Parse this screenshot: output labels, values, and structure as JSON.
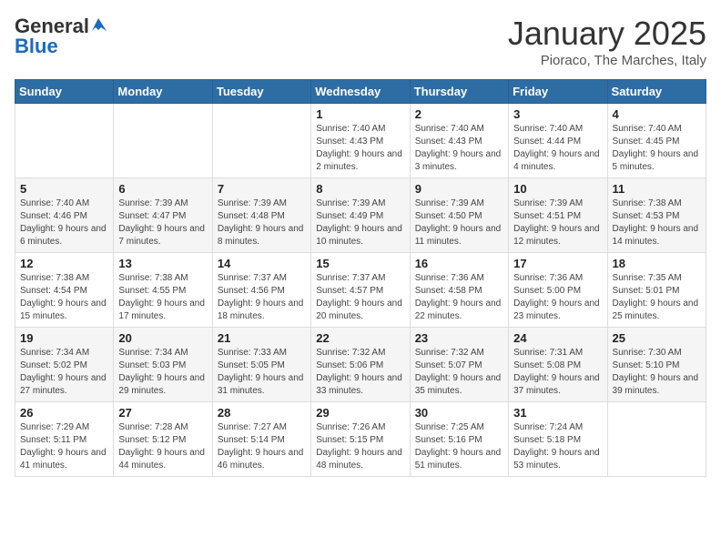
{
  "header": {
    "logo_general": "General",
    "logo_blue": "Blue",
    "month_title": "January 2025",
    "location": "Pioraco, The Marches, Italy"
  },
  "days_of_week": [
    "Sunday",
    "Monday",
    "Tuesday",
    "Wednesday",
    "Thursday",
    "Friday",
    "Saturday"
  ],
  "weeks": [
    [
      {
        "day": "",
        "info": ""
      },
      {
        "day": "",
        "info": ""
      },
      {
        "day": "",
        "info": ""
      },
      {
        "day": "1",
        "info": "Sunrise: 7:40 AM\nSunset: 4:43 PM\nDaylight: 9 hours and 2 minutes."
      },
      {
        "day": "2",
        "info": "Sunrise: 7:40 AM\nSunset: 4:43 PM\nDaylight: 9 hours and 3 minutes."
      },
      {
        "day": "3",
        "info": "Sunrise: 7:40 AM\nSunset: 4:44 PM\nDaylight: 9 hours and 4 minutes."
      },
      {
        "day": "4",
        "info": "Sunrise: 7:40 AM\nSunset: 4:45 PM\nDaylight: 9 hours and 5 minutes."
      }
    ],
    [
      {
        "day": "5",
        "info": "Sunrise: 7:40 AM\nSunset: 4:46 PM\nDaylight: 9 hours and 6 minutes."
      },
      {
        "day": "6",
        "info": "Sunrise: 7:39 AM\nSunset: 4:47 PM\nDaylight: 9 hours and 7 minutes."
      },
      {
        "day": "7",
        "info": "Sunrise: 7:39 AM\nSunset: 4:48 PM\nDaylight: 9 hours and 8 minutes."
      },
      {
        "day": "8",
        "info": "Sunrise: 7:39 AM\nSunset: 4:49 PM\nDaylight: 9 hours and 10 minutes."
      },
      {
        "day": "9",
        "info": "Sunrise: 7:39 AM\nSunset: 4:50 PM\nDaylight: 9 hours and 11 minutes."
      },
      {
        "day": "10",
        "info": "Sunrise: 7:39 AM\nSunset: 4:51 PM\nDaylight: 9 hours and 12 minutes."
      },
      {
        "day": "11",
        "info": "Sunrise: 7:38 AM\nSunset: 4:53 PM\nDaylight: 9 hours and 14 minutes."
      }
    ],
    [
      {
        "day": "12",
        "info": "Sunrise: 7:38 AM\nSunset: 4:54 PM\nDaylight: 9 hours and 15 minutes."
      },
      {
        "day": "13",
        "info": "Sunrise: 7:38 AM\nSunset: 4:55 PM\nDaylight: 9 hours and 17 minutes."
      },
      {
        "day": "14",
        "info": "Sunrise: 7:37 AM\nSunset: 4:56 PM\nDaylight: 9 hours and 18 minutes."
      },
      {
        "day": "15",
        "info": "Sunrise: 7:37 AM\nSunset: 4:57 PM\nDaylight: 9 hours and 20 minutes."
      },
      {
        "day": "16",
        "info": "Sunrise: 7:36 AM\nSunset: 4:58 PM\nDaylight: 9 hours and 22 minutes."
      },
      {
        "day": "17",
        "info": "Sunrise: 7:36 AM\nSunset: 5:00 PM\nDaylight: 9 hours and 23 minutes."
      },
      {
        "day": "18",
        "info": "Sunrise: 7:35 AM\nSunset: 5:01 PM\nDaylight: 9 hours and 25 minutes."
      }
    ],
    [
      {
        "day": "19",
        "info": "Sunrise: 7:34 AM\nSunset: 5:02 PM\nDaylight: 9 hours and 27 minutes."
      },
      {
        "day": "20",
        "info": "Sunrise: 7:34 AM\nSunset: 5:03 PM\nDaylight: 9 hours and 29 minutes."
      },
      {
        "day": "21",
        "info": "Sunrise: 7:33 AM\nSunset: 5:05 PM\nDaylight: 9 hours and 31 minutes."
      },
      {
        "day": "22",
        "info": "Sunrise: 7:32 AM\nSunset: 5:06 PM\nDaylight: 9 hours and 33 minutes."
      },
      {
        "day": "23",
        "info": "Sunrise: 7:32 AM\nSunset: 5:07 PM\nDaylight: 9 hours and 35 minutes."
      },
      {
        "day": "24",
        "info": "Sunrise: 7:31 AM\nSunset: 5:08 PM\nDaylight: 9 hours and 37 minutes."
      },
      {
        "day": "25",
        "info": "Sunrise: 7:30 AM\nSunset: 5:10 PM\nDaylight: 9 hours and 39 minutes."
      }
    ],
    [
      {
        "day": "26",
        "info": "Sunrise: 7:29 AM\nSunset: 5:11 PM\nDaylight: 9 hours and 41 minutes."
      },
      {
        "day": "27",
        "info": "Sunrise: 7:28 AM\nSunset: 5:12 PM\nDaylight: 9 hours and 44 minutes."
      },
      {
        "day": "28",
        "info": "Sunrise: 7:27 AM\nSunset: 5:14 PM\nDaylight: 9 hours and 46 minutes."
      },
      {
        "day": "29",
        "info": "Sunrise: 7:26 AM\nSunset: 5:15 PM\nDaylight: 9 hours and 48 minutes."
      },
      {
        "day": "30",
        "info": "Sunrise: 7:25 AM\nSunset: 5:16 PM\nDaylight: 9 hours and 51 minutes."
      },
      {
        "day": "31",
        "info": "Sunrise: 7:24 AM\nSunset: 5:18 PM\nDaylight: 9 hours and 53 minutes."
      },
      {
        "day": "",
        "info": ""
      }
    ]
  ]
}
